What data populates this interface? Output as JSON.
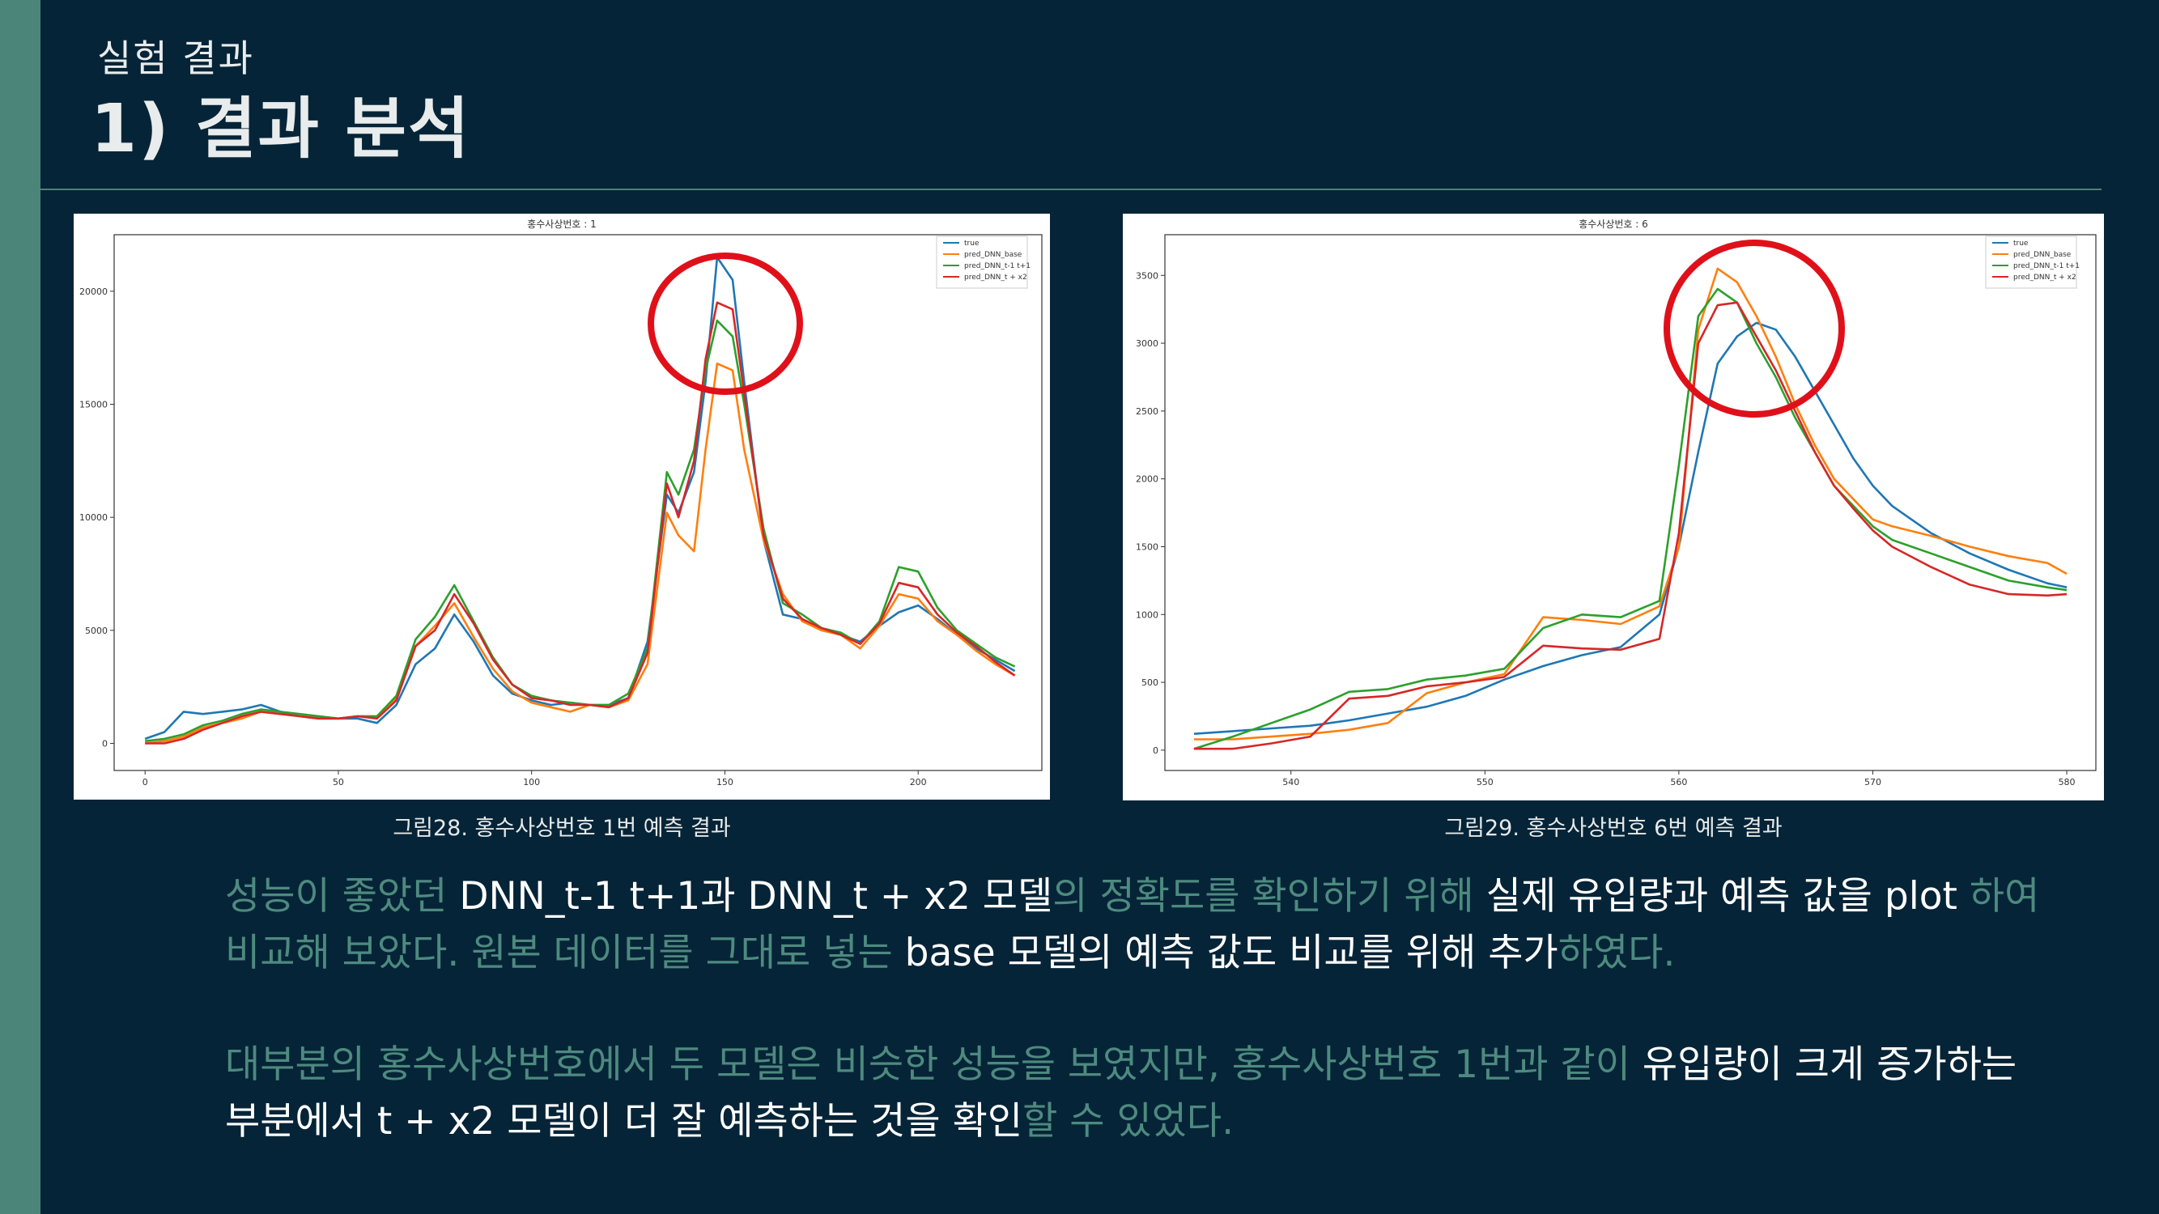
{
  "slide": {
    "subtitle": "실험 결과",
    "title": "1) 결과 분석",
    "colors": {
      "background": "#062437",
      "accent": "#4b8479",
      "highlight": "#ffffff",
      "dim": "#4d8a7f"
    }
  },
  "figures": [
    {
      "caption": "그림28. 홍수사상번호 1번 예측 결과"
    },
    {
      "caption": "그림29. 홍수사상번호 6번 예측 결과"
    }
  ],
  "paragraphs": [
    {
      "lines": [
        [
          {
            "t": "성능이 좋았던 ",
            "h": false
          },
          {
            "t": "DNN_t-1 t+1과 DNN_t + x2 모델",
            "h": true
          },
          {
            "t": "의 정확도를 확인하기 위해 ",
            "h": false
          },
          {
            "t": "실제 유입량과 예측 값을 plot ",
            "h": true
          },
          {
            "t": "하여",
            "h": false
          }
        ],
        [
          {
            "t": "비교해 보았다. 원본 데이터를 그대로 넣는 ",
            "h": false
          },
          {
            "t": "base 모델의 예측 값도 비교를 위해 추가",
            "h": true
          },
          {
            "t": "하였다.",
            "h": false
          }
        ]
      ]
    },
    {
      "lines": [
        [
          {
            "t": "대부분의 홍수사상번호에서 두 모델은 비슷한 성능을 보였지만, 홍수사상번호 1번과 같이 ",
            "h": false
          },
          {
            "t": "유입량이 크게 증가하는",
            "h": true
          }
        ],
        [
          {
            "t": "부분에서 t + x2 모델이 더 잘 예측하는 것을 확인",
            "h": true
          },
          {
            "t": "할 수 있었다.",
            "h": false
          }
        ]
      ]
    }
  ],
  "chart_data": [
    {
      "type": "line",
      "title": "홍수사상번호 : 1",
      "xlim": [
        -8,
        232
      ],
      "ylim": [
        -1200,
        22500
      ],
      "x_ticks": [
        0,
        50,
        100,
        150,
        200
      ],
      "y_ticks": [
        0,
        5000,
        10000,
        15000,
        20000
      ],
      "legend_position": "top-right",
      "x": [
        0,
        5,
        10,
        15,
        20,
        25,
        30,
        35,
        40,
        45,
        50,
        55,
        60,
        65,
        70,
        75,
        80,
        85,
        90,
        95,
        100,
        105,
        110,
        115,
        120,
        125,
        130,
        135,
        138,
        142,
        145,
        148,
        152,
        155,
        160,
        165,
        170,
        175,
        180,
        185,
        190,
        195,
        200,
        205,
        210,
        215,
        220,
        225
      ],
      "series": [
        {
          "name": "true",
          "color": "#1f77b4",
          "values": [
            200,
            500,
            1400,
            1300,
            1400,
            1500,
            1700,
            1400,
            1200,
            1100,
            1100,
            1100,
            900,
            1700,
            3500,
            4200,
            5700,
            4500,
            3000,
            2200,
            1900,
            1700,
            1800,
            1700,
            1700,
            2000,
            4500,
            11000,
            10200,
            12000,
            16000,
            21500,
            20500,
            16000,
            9000,
            5700,
            5500,
            5000,
            4800,
            4500,
            5200,
            5800,
            6100,
            5500,
            4800,
            4200,
            3700,
            3200
          ]
        },
        {
          "name": "pred_DNN_base",
          "color": "#ff7f0e",
          "values": [
            0,
            100,
            300,
            700,
            900,
            1100,
            1400,
            1300,
            1200,
            1200,
            1100,
            1200,
            1200,
            2000,
            4300,
            5200,
            6200,
            4700,
            3300,
            2300,
            1800,
            1600,
            1400,
            1700,
            1600,
            1900,
            3500,
            10200,
            9200,
            8500,
            13000,
            16800,
            16500,
            13000,
            9000,
            6600,
            5400,
            5000,
            4800,
            4200,
            5200,
            6600,
            6400,
            5400,
            4800,
            4100,
            3500,
            3000
          ]
        },
        {
          "name": "pred_DNN_t-1 t+1",
          "color": "#2ca02c",
          "values": [
            100,
            200,
            400,
            800,
            1000,
            1300,
            1500,
            1400,
            1300,
            1200,
            1100,
            1200,
            1200,
            2100,
            4600,
            5600,
            7000,
            5400,
            3800,
            2600,
            2100,
            1900,
            1800,
            1700,
            1700,
            2200,
            4200,
            12000,
            11000,
            13000,
            16500,
            18700,
            18000,
            15000,
            9500,
            6200,
            5700,
            5100,
            4900,
            4400,
            5400,
            7800,
            7600,
            6000,
            5000,
            4400,
            3800,
            3400
          ]
        },
        {
          "name": "pred_DNN_t + x2",
          "color": "#d62728",
          "values": [
            0,
            0,
            200,
            600,
            900,
            1200,
            1400,
            1300,
            1200,
            1100,
            1100,
            1200,
            1100,
            1900,
            4300,
            5000,
            6600,
            5300,
            3700,
            2600,
            2000,
            1900,
            1700,
            1700,
            1600,
            2000,
            4000,
            11500,
            10000,
            12500,
            17000,
            19500,
            19200,
            15500,
            9200,
            6400,
            5500,
            5100,
            4800,
            4400,
            5300,
            7100,
            6900,
            5700,
            4900,
            4300,
            3600,
            3000
          ]
        }
      ]
    },
    {
      "type": "line",
      "title": "홍수사상번호 : 6",
      "xlim": [
        533.5,
        581.5
      ],
      "ylim": [
        -150,
        3800
      ],
      "x_ticks": [
        540,
        550,
        560,
        570,
        580
      ],
      "y_ticks": [
        0,
        500,
        1000,
        1500,
        2000,
        2500,
        3000,
        3500
      ],
      "legend_position": "top-right",
      "x": [
        535,
        537,
        539,
        541,
        543,
        545,
        547,
        549,
        551,
        553,
        555,
        557,
        559,
        560,
        561,
        562,
        563,
        564,
        565,
        566,
        567,
        568,
        569,
        570,
        571,
        573,
        575,
        577,
        579,
        580
      ],
      "series": [
        {
          "name": "true",
          "color": "#1f77b4",
          "values": [
            120,
            140,
            160,
            180,
            220,
            270,
            320,
            400,
            520,
            620,
            700,
            760,
            1000,
            1500,
            2200,
            2850,
            3050,
            3150,
            3100,
            2900,
            2650,
            2400,
            2150,
            1950,
            1800,
            1600,
            1450,
            1330,
            1230,
            1200
          ]
        },
        {
          "name": "pred_DNN_base",
          "color": "#ff7f0e",
          "values": [
            80,
            80,
            100,
            120,
            150,
            200,
            420,
            500,
            560,
            980,
            960,
            930,
            1060,
            1500,
            3100,
            3550,
            3450,
            3200,
            2900,
            2550,
            2250,
            2000,
            1850,
            1700,
            1650,
            1580,
            1500,
            1430,
            1380,
            1300
          ]
        },
        {
          "name": "pred_DNN_t-1 t+1",
          "color": "#2ca02c",
          "values": [
            10,
            100,
            200,
            300,
            430,
            450,
            520,
            550,
            600,
            900,
            1000,
            980,
            1100,
            2100,
            3200,
            3400,
            3300,
            3000,
            2750,
            2450,
            2200,
            1950,
            1800,
            1650,
            1550,
            1450,
            1350,
            1250,
            1200,
            1180
          ]
        },
        {
          "name": "pred_DNN_t + x2",
          "color": "#d62728",
          "values": [
            10,
            10,
            50,
            100,
            380,
            400,
            470,
            500,
            540,
            770,
            750,
            740,
            820,
            1600,
            3000,
            3280,
            3300,
            3050,
            2800,
            2500,
            2200,
            1950,
            1780,
            1620,
            1500,
            1350,
            1220,
            1150,
            1140,
            1150
          ]
        }
      ]
    }
  ]
}
